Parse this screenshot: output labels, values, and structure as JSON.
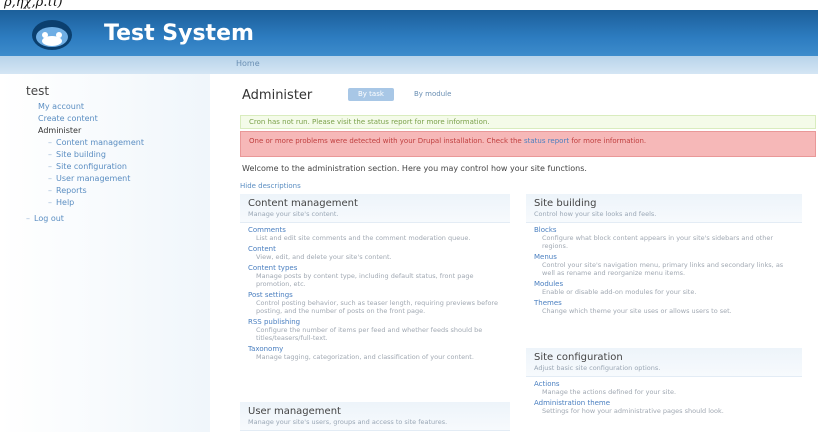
{
  "header": {
    "site_name": "Test System"
  },
  "breadcrumb": "Home",
  "sidebar": {
    "title": "test",
    "items": [
      {
        "label": "My account"
      },
      {
        "label": "Create content"
      },
      {
        "label": "Administer"
      },
      {
        "label": "Content management"
      },
      {
        "label": "Site building"
      },
      {
        "label": "Site configuration"
      },
      {
        "label": "User management"
      },
      {
        "label": "Reports"
      },
      {
        "label": "Help"
      },
      {
        "label": "Log out"
      }
    ]
  },
  "main": {
    "title": "Administer",
    "tabs": [
      {
        "label": "By task"
      },
      {
        "label": "By module"
      }
    ],
    "status_message": "Cron has not run. Please visit the status report for more information.",
    "error_message_before": "One or more problems were detected with your Drupal installation. Check the",
    "error_link": "status report",
    "error_message_after": "for more information.",
    "welcome": "Welcome to the administration section. Here you may control how your site functions.",
    "hide_descriptions": "Hide descriptions",
    "content_management": {
      "title": "Content management",
      "description": "Manage your site's content.",
      "entries": [
        {
          "title": "Comments",
          "description": "List and edit site comments and the comment moderation queue."
        },
        {
          "title": "Content",
          "description": "View, edit, and delete your site's content."
        },
        {
          "title": "Content types",
          "description": "Manage posts by content type, including default status, front page promotion, etc."
        },
        {
          "title": "Post settings",
          "description": "Control posting behavior, such as teaser length, requiring previews before posting, and the number of posts on the front page."
        },
        {
          "title": "RSS publishing",
          "description": "Configure the number of items per feed and whether feeds should be titles/teasers/full-text."
        },
        {
          "title": "Taxonomy",
          "description": "Manage tagging, categorization, and classification of your content."
        }
      ]
    },
    "user_management": {
      "title": "User management",
      "description": "Manage your site's users, groups and access to site features."
    },
    "site_building": {
      "title": "Site building",
      "description": "Control how your site looks and feels.",
      "entries": [
        {
          "title": "Blocks",
          "description": "Configure what block content appears in your site's sidebars and other regions."
        },
        {
          "title": "Menus",
          "description": "Control your site's navigation menu, primary links and secondary links, as well as rename and reorganize menu items."
        },
        {
          "title": "Modules",
          "description": "Enable or disable add-on modules for your site."
        },
        {
          "title": "Themes",
          "description": "Change which theme your site uses or allows users to set."
        }
      ]
    },
    "site_configuration": {
      "title": "Site configuration",
      "description": "Adjust basic site configuration options.",
      "entries": [
        {
          "title": "Actions",
          "description": "Manage the actions defined for your site."
        },
        {
          "title": "Administration theme",
          "description": "Settings for how your administrative pages should look."
        }
      ]
    }
  }
}
